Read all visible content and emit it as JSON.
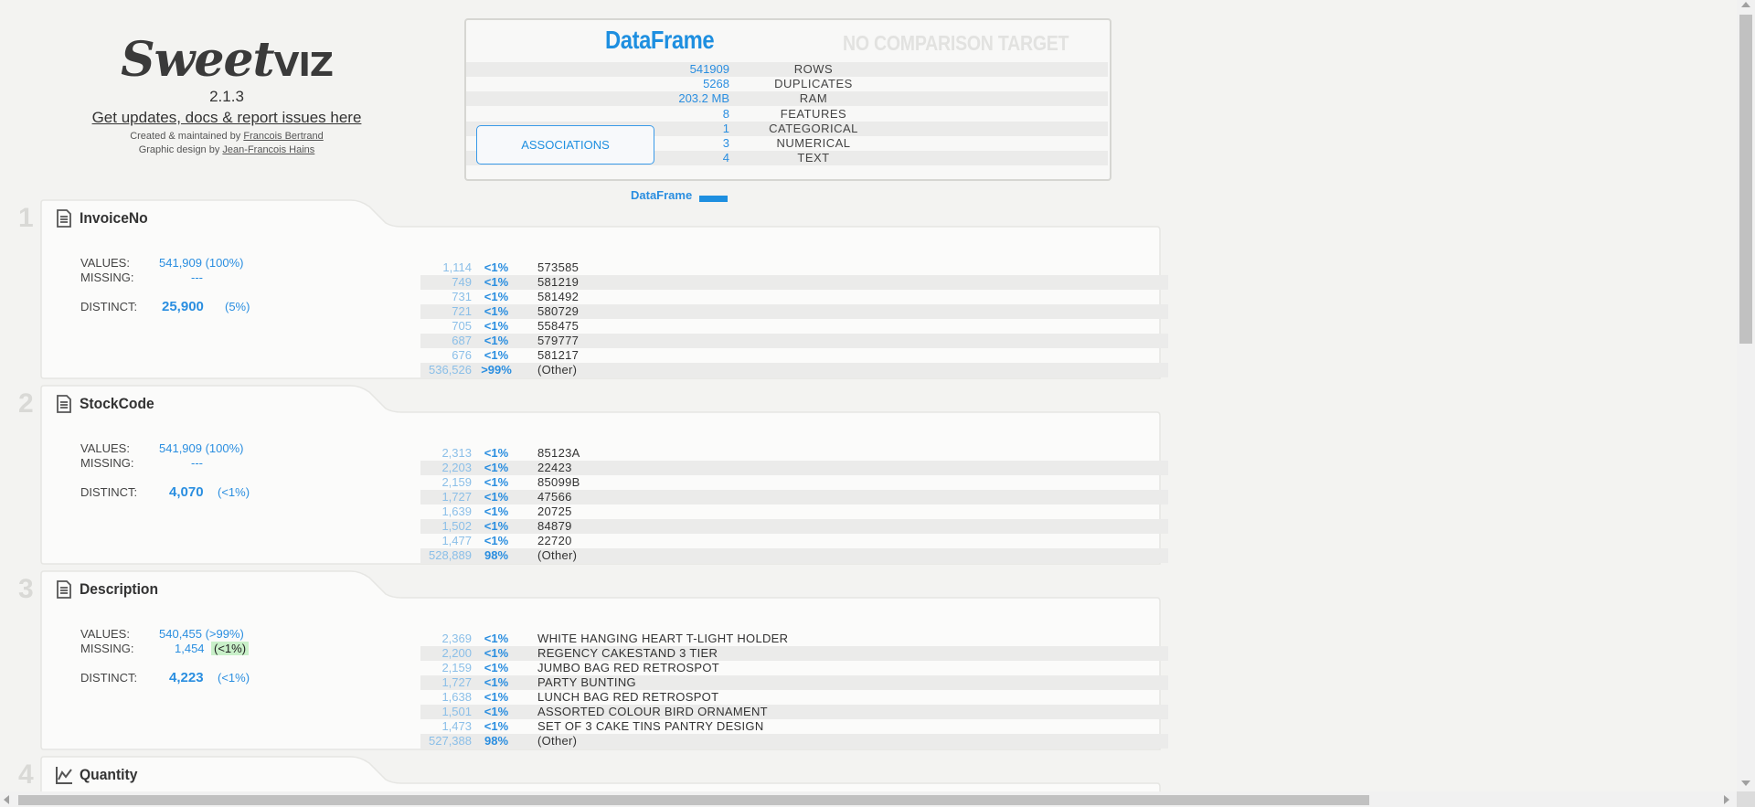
{
  "header": {
    "logo_text": "Sweetviz",
    "version": "2.1.3",
    "updates_link": "Get updates, docs & report issues here",
    "created_by_prefix": "Created & maintained by",
    "created_by_name": "Francois Bertrand",
    "design_prefix": "Graphic design by",
    "design_name": "Jean-Francois Hains"
  },
  "summary": {
    "title": "DataFrame",
    "comparison": "NO COMPARISON TARGET",
    "stats": [
      {
        "value": "541909",
        "label": "ROWS"
      },
      {
        "value": "5268",
        "label": "DUPLICATES"
      },
      {
        "value": "203.2 MB",
        "label": "RAM"
      },
      {
        "value": "8",
        "label": "FEATURES"
      },
      {
        "value": "1",
        "label": "CATEGORICAL"
      },
      {
        "value": "3",
        "label": "NUMERICAL"
      },
      {
        "value": "4",
        "label": "TEXT"
      }
    ],
    "associations_button": "ASSOCIATIONS",
    "legend_label": "DataFrame",
    "accent_color": "#1e8fe0"
  },
  "features": [
    {
      "number": "1",
      "name": "InvoiceNo",
      "icon": "document-icon",
      "values_label": "VALUES:",
      "values": "541,909 (100%)",
      "missing_label": "MISSING:",
      "missing": "---",
      "missing_pct": "",
      "distinct_label": "DISTINCT:",
      "distinct": "25,900",
      "distinct_pct": "(5%)",
      "top_values": [
        {
          "count": "1,114",
          "pct": "<1%",
          "value": "573585"
        },
        {
          "count": "749",
          "pct": "<1%",
          "value": "581219"
        },
        {
          "count": "731",
          "pct": "<1%",
          "value": "581492"
        },
        {
          "count": "721",
          "pct": "<1%",
          "value": "580729"
        },
        {
          "count": "705",
          "pct": "<1%",
          "value": "558475"
        },
        {
          "count": "687",
          "pct": "<1%",
          "value": "579777"
        },
        {
          "count": "676",
          "pct": "<1%",
          "value": "581217"
        },
        {
          "count": "536,526",
          "pct": ">99%",
          "value": "(Other)"
        }
      ]
    },
    {
      "number": "2",
      "name": "StockCode",
      "icon": "document-icon",
      "values_label": "VALUES:",
      "values": "541,909 (100%)",
      "missing_label": "MISSING:",
      "missing": "---",
      "missing_pct": "",
      "distinct_label": "DISTINCT:",
      "distinct": "4,070",
      "distinct_pct": "(<1%)",
      "top_values": [
        {
          "count": "2,313",
          "pct": "<1%",
          "value": "85123A"
        },
        {
          "count": "2,203",
          "pct": "<1%",
          "value": "22423"
        },
        {
          "count": "2,159",
          "pct": "<1%",
          "value": "85099B"
        },
        {
          "count": "1,727",
          "pct": "<1%",
          "value": "47566"
        },
        {
          "count": "1,639",
          "pct": "<1%",
          "value": "20725"
        },
        {
          "count": "1,502",
          "pct": "<1%",
          "value": "84879"
        },
        {
          "count": "1,477",
          "pct": "<1%",
          "value": "22720"
        },
        {
          "count": "528,889",
          "pct": "98%",
          "value": "(Other)"
        }
      ]
    },
    {
      "number": "3",
      "name": "Description",
      "icon": "document-icon",
      "values_label": "VALUES:",
      "values": "540,455 (>99%)",
      "missing_label": "MISSING:",
      "missing": "1,454",
      "missing_pct": "(<1%)",
      "distinct_label": "DISTINCT:",
      "distinct": "4,223",
      "distinct_pct": "(<1%)",
      "top_values": [
        {
          "count": "2,369",
          "pct": "<1%",
          "value": "WHITE HANGING HEART T-LIGHT HOLDER"
        },
        {
          "count": "2,200",
          "pct": "<1%",
          "value": "REGENCY CAKESTAND 3 TIER"
        },
        {
          "count": "2,159",
          "pct": "<1%",
          "value": "JUMBO BAG RED RETROSPOT"
        },
        {
          "count": "1,727",
          "pct": "<1%",
          "value": "PARTY BUNTING"
        },
        {
          "count": "1,638",
          "pct": "<1%",
          "value": "LUNCH BAG RED RETROSPOT"
        },
        {
          "count": "1,501",
          "pct": "<1%",
          "value": "ASSORTED COLOUR BIRD ORNAMENT"
        },
        {
          "count": "1,473",
          "pct": "<1%",
          "value": "SET OF 3 CAKE TINS PANTRY DESIGN"
        },
        {
          "count": "527,388",
          "pct": "98%",
          "value": "(Other)"
        }
      ]
    },
    {
      "number": "4",
      "name": "Quantity",
      "icon": "line-chart-icon"
    }
  ]
}
